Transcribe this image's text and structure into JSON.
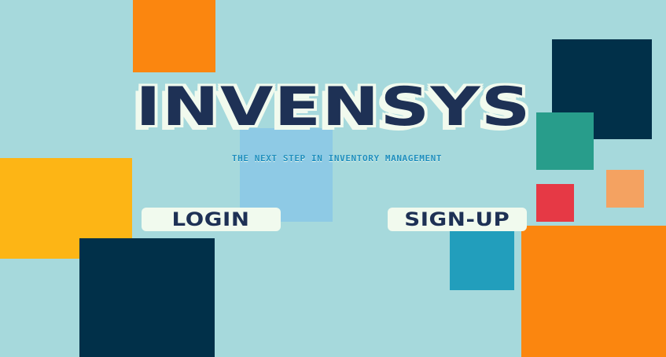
{
  "app": {
    "title": "INVENSYS",
    "tagline": "THE NEXT STEP IN INVENTORY MANAGEMENT"
  },
  "actions": {
    "login_label": "LOGIN",
    "signup_label": "SIGN-UP"
  },
  "colors": {
    "background": "#a6d9dc",
    "title": "#1e3155",
    "title_outline": "#f1faee",
    "tagline": "#1f8fbf",
    "button_bg": "#f1faee",
    "orange": "#fb860f",
    "yellow": "#fdb515",
    "navy": "#013049",
    "light_blue": "#8ecae5",
    "teal": "#289d8b",
    "peach": "#f4a261",
    "red": "#e63945",
    "blue": "#229ebc"
  }
}
